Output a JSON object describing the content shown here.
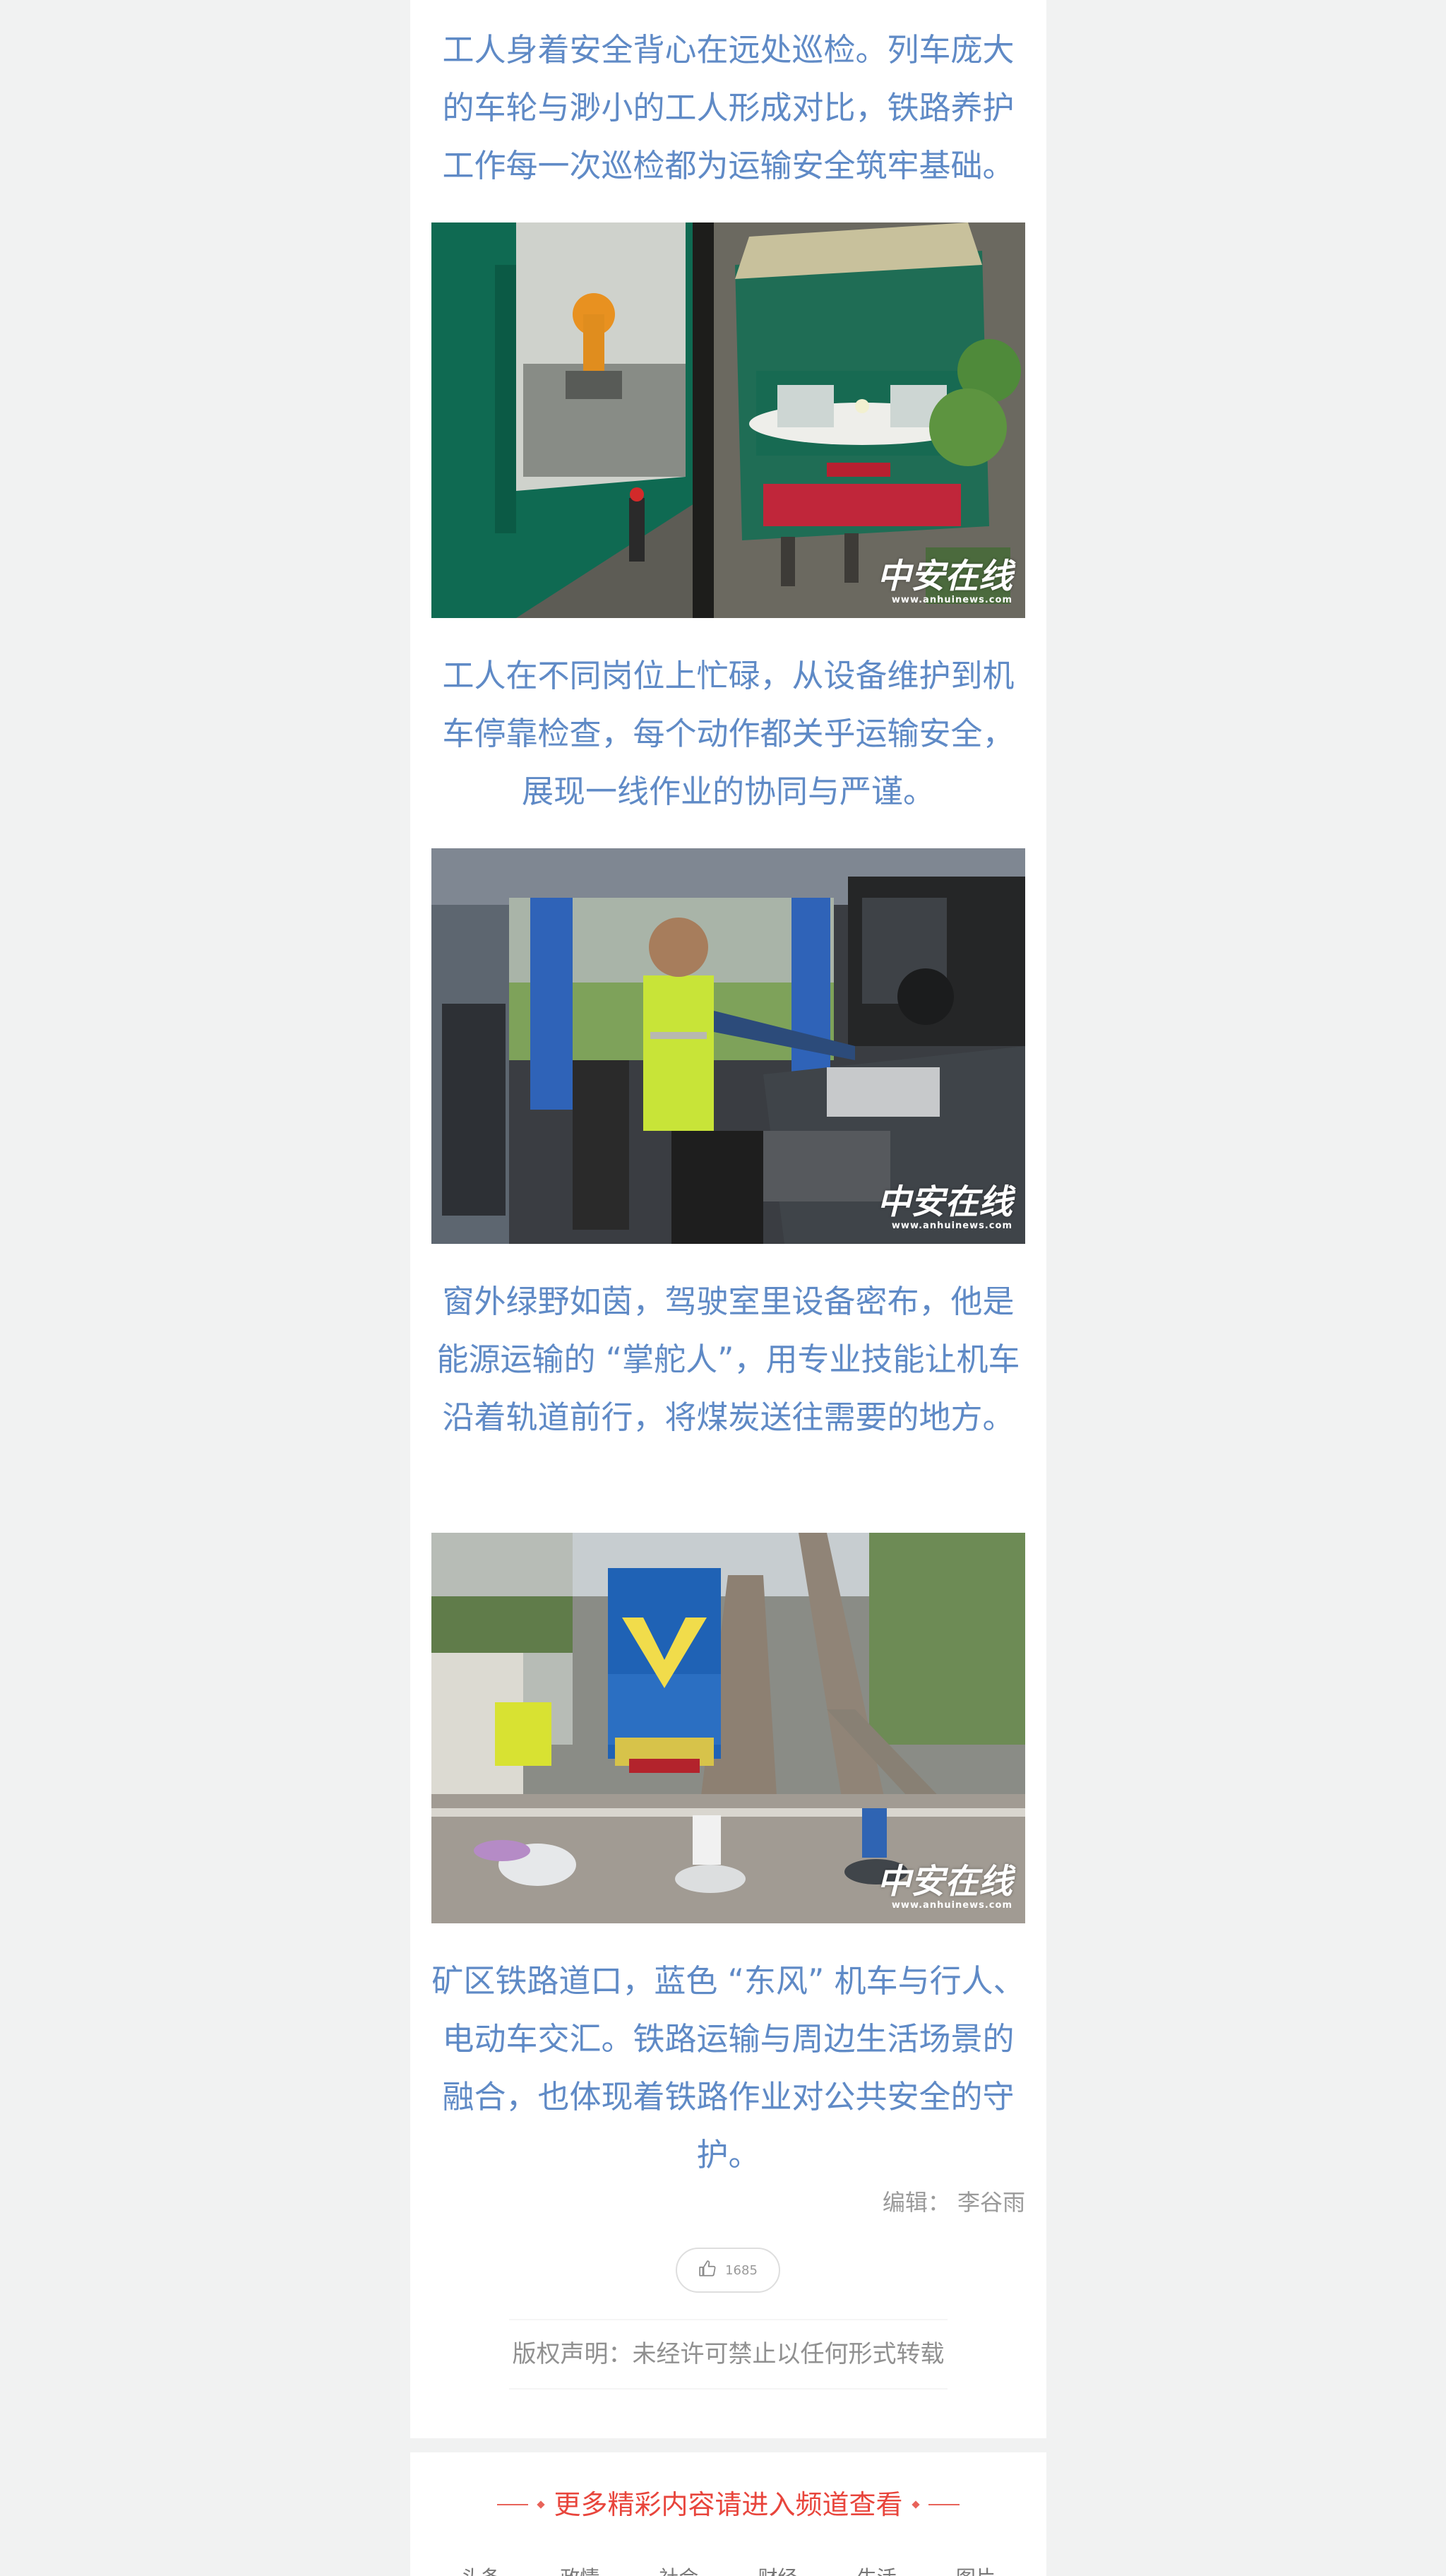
{
  "captions": [
    "工人身着安全背心在远处巡检。列车庞大的车轮与渺小的工人形成对比，铁路养护工作每一次巡检都为运输安全筑牢基础。",
    "工人在不同岗位上忙碌，从设备维护到机车停靠检查，每个动作都关乎运输安全，展现一线作业的协同与严谨。",
    "窗外绿野如茵，驾驶室里设备密布，他是能源运输的 “掌舵人”，用专业技能让机车沿着轨道前行，将煤炭送往需要的地方。",
    "矿区铁路道口，蓝色 “东风” 机车与行人、电动车交汇。铁路运输与周边生活场景的融合，也体现着铁路作业对公共安全的守护。"
  ],
  "watermark": {
    "logo_text": "中安在线",
    "url": "www.anhuinews.com"
  },
  "editor": "编辑： 李谷雨",
  "like": {
    "count": "1685"
  },
  "copyright": "版权声明：未经许可禁止以任何形式转载",
  "more": {
    "title": "更多精彩内容请进入频道查看",
    "channels": [
      "头条",
      "政情",
      "社会",
      "财经",
      "生活",
      "图片"
    ]
  },
  "colors": {
    "caption": "#5f8ac6",
    "accent": "#e8453c",
    "page_bg": "#f1f2f2"
  },
  "icons": {
    "like": "thumbs-up-icon"
  }
}
